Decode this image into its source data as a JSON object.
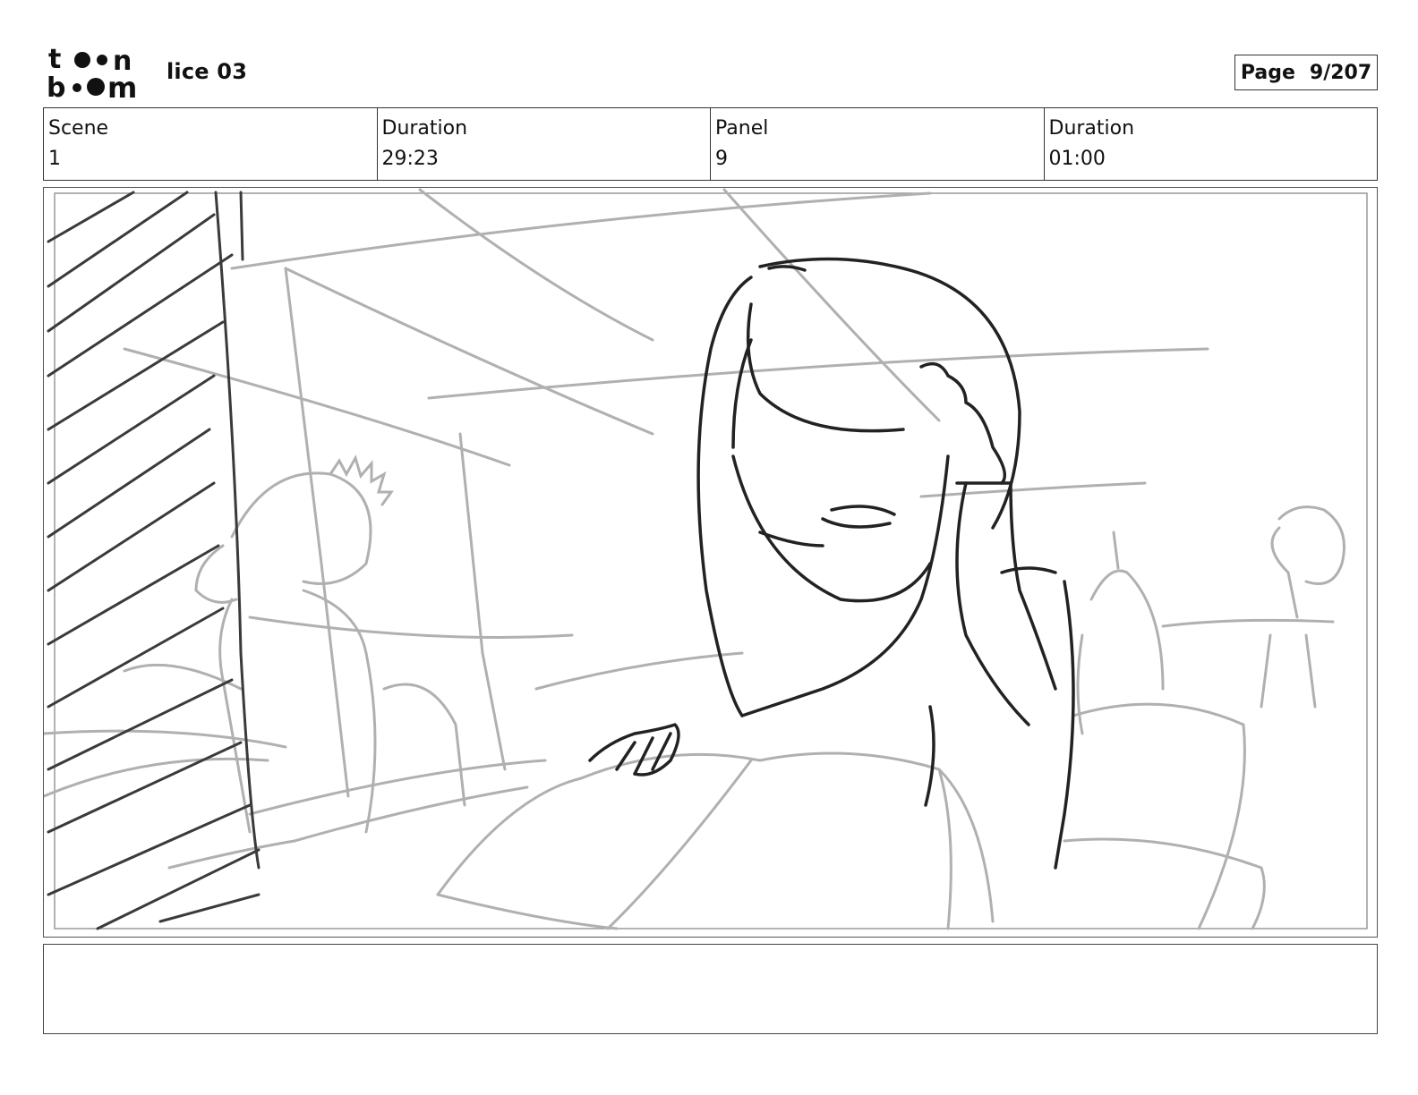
{
  "header": {
    "logo_name": "toon boom",
    "project_title": "lice 03",
    "page_label": "Page",
    "page_value": "9/207"
  },
  "info": {
    "scene_label": "Scene",
    "scene_value": "1",
    "scene_duration_label": "Duration",
    "scene_duration_value": "29:23",
    "panel_label": "Panel",
    "panel_value": "9",
    "panel_duration_label": "Duration",
    "panel_duration_value": "01:00"
  },
  "caption": {
    "text": ""
  },
  "colors": {
    "ink": "#222222",
    "sketch_gray": "#b0b0b0",
    "frame": "#555555"
  }
}
